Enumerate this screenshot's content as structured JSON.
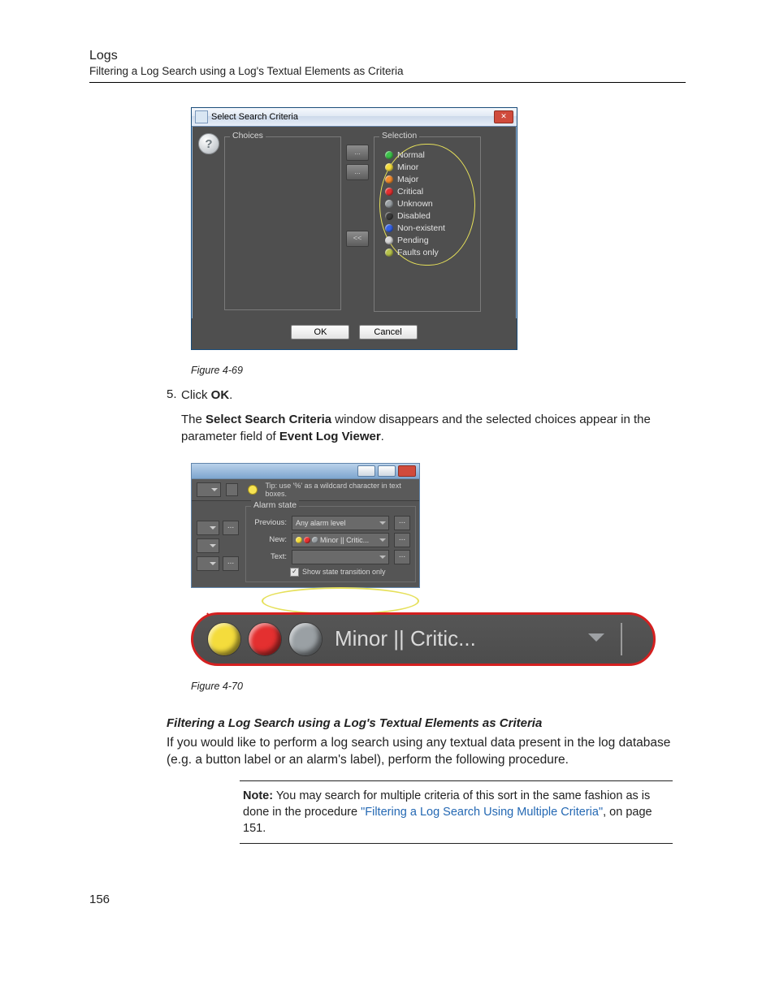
{
  "header": {
    "title": "Logs",
    "subtitle": "Filtering a Log Search using a Log's Textual Elements as Criteria"
  },
  "dialog1": {
    "title": "Select Search Criteria",
    "close_glyph": "✕",
    "help_glyph": "?",
    "choices_label": "Choices",
    "selection_label": "Selection",
    "move_up": "...",
    "move_up2": "...",
    "move_all": "<<",
    "items": [
      {
        "label": "Normal",
        "color": "#3cc24a"
      },
      {
        "label": "Minor",
        "color": "#f4dc3c"
      },
      {
        "label": "Major",
        "color": "#f48b2c"
      },
      {
        "label": "Critical",
        "color": "#e43030"
      },
      {
        "label": "Unknown",
        "color": "#9aa0a4"
      },
      {
        "label": "Disabled",
        "color": "#3a3a3a"
      },
      {
        "label": "Non-existent",
        "color": "#3562e8"
      },
      {
        "label": "Pending",
        "color": "#d8d8d8"
      },
      {
        "label": "Faults only",
        "color": "#b7c24a"
      }
    ],
    "ok": "OK",
    "cancel": "Cancel"
  },
  "caption1": "Figure 4-69",
  "step5": {
    "num": "5.",
    "line1_pre": "Click ",
    "line1_bold": "OK",
    "line1_post": ".",
    "line2_pre": "The ",
    "line2_b1": "Select Search Criteria",
    "line2_mid": " window disappears and the selected choices appear in the parameter field of ",
    "line2_b2": "Event Log Viewer",
    "line2_post": "."
  },
  "elv": {
    "tip_label": "Tip: use '%' as a wildcard character in text boxes.",
    "alarm_label": "Alarm state",
    "previous": "Previous:",
    "previous_value": "Any alarm level",
    "new": "New:",
    "new_value": "Minor || Critic...",
    "text": "Text:",
    "show_trans": "Show state transition only"
  },
  "zoom": {
    "text": "Minor || Critic...",
    "dots": [
      "#f4dc3c",
      "#e43030",
      "#9aa0a4"
    ]
  },
  "caption2": "Figure 4-70",
  "section_title": "Filtering a Log Search using a Log's Textual Elements as Criteria",
  "para1": "If you would like to perform a log search using any textual data present in the log database (e.g. a button label or an alarm's label), perform the following procedure.",
  "note": {
    "label": "Note:",
    "body_pre": "   You may search for multiple criteria of this sort in the same fashion as is done in the procedure ",
    "link": "\"Filtering a Log Search Using Multiple Criteria\"",
    "body_post": ", on page 151."
  },
  "page_number": "156"
}
